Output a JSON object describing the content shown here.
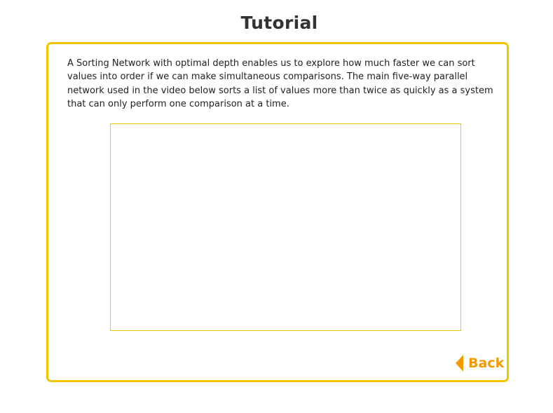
{
  "header": {
    "title": "Tutorial"
  },
  "tutorial": {
    "intro_text": "A Sorting Network with optimal depth enables us to explore how much faster we can sort values into order if we can make simultaneous comparisons. The main five-way parallel network used in the video below sorts a list of values more than twice as quickly as a system that can only perform one comparison at a time."
  },
  "navigation": {
    "back_label": "Back",
    "back_icon": "chevron-left-icon"
  },
  "colors": {
    "panel_border": "#F5C400",
    "video_border": "#F0C800",
    "accent": "#F39A00",
    "title": "#333333"
  }
}
